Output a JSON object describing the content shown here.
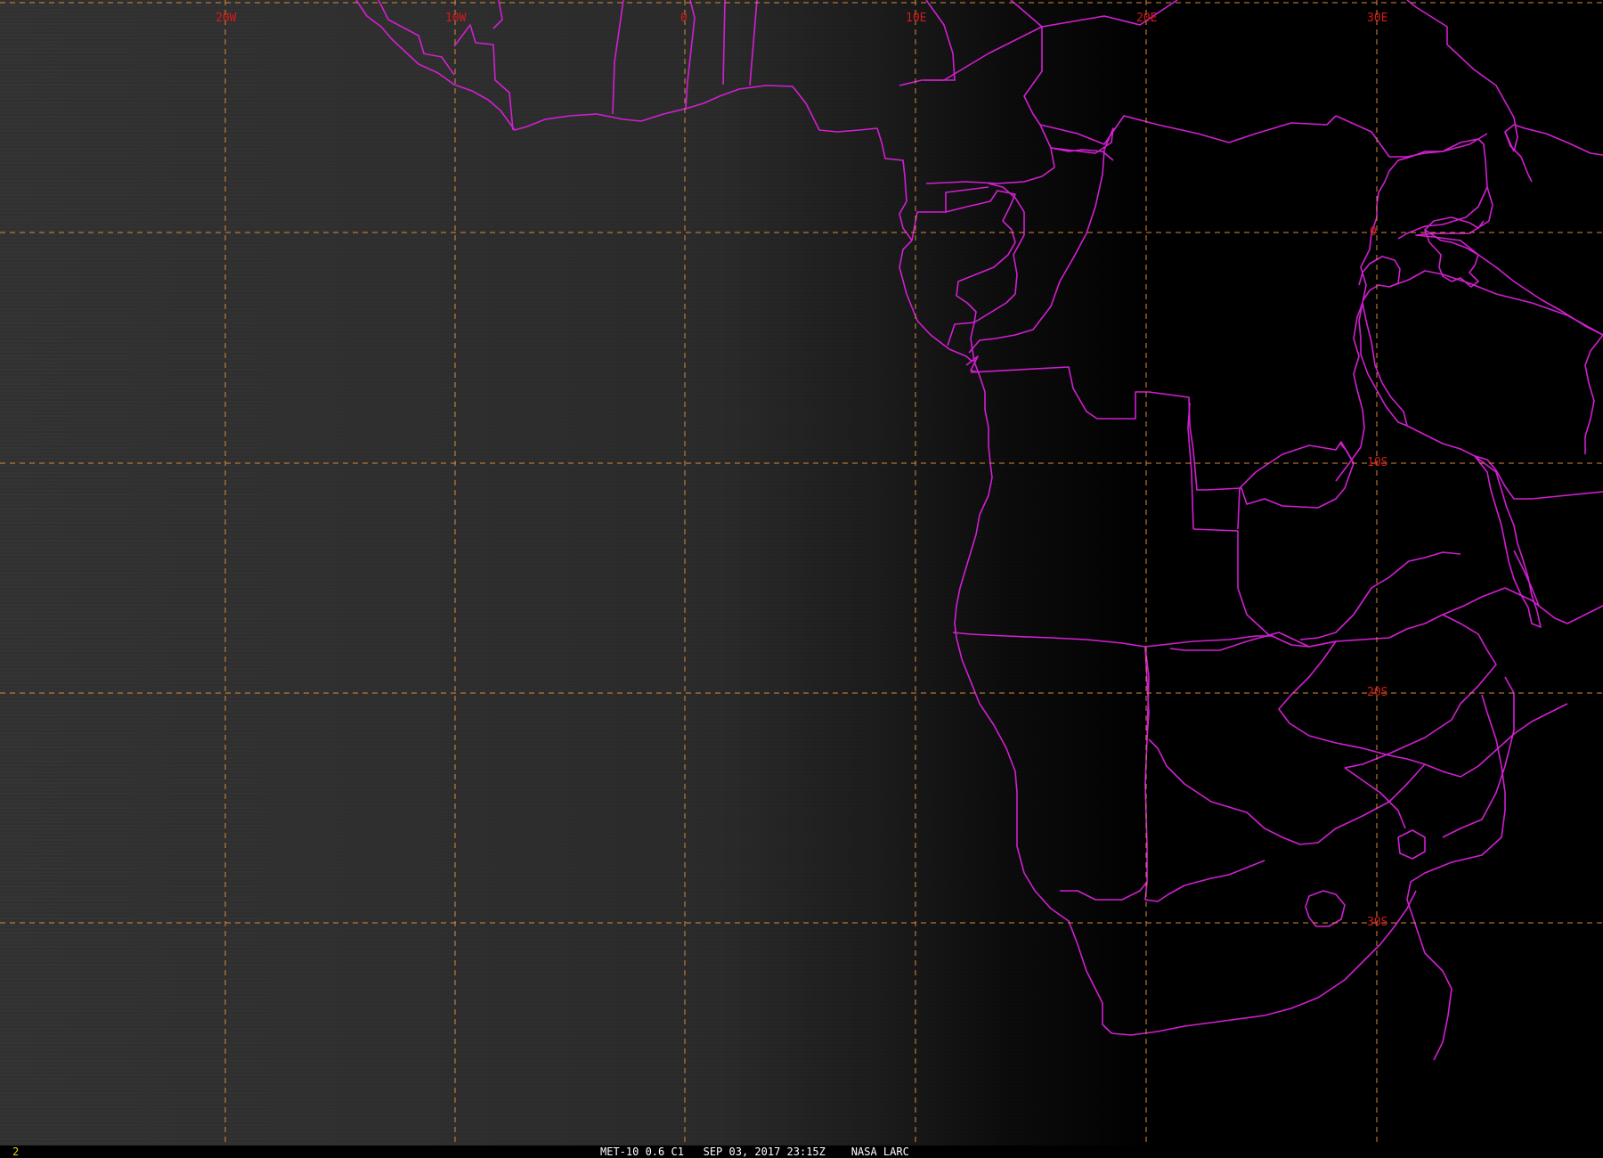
{
  "image": {
    "status_bar": {
      "frame_number": "2",
      "satellite_product": "MET-10 0.6 C1",
      "date_time": "SEP 03, 2017 23:15Z",
      "source": "NASA LARC"
    },
    "grid_labels": {
      "longitude": [
        "20W",
        "10W",
        "0",
        "10E",
        "20E",
        "30E"
      ],
      "latitude": [
        "0",
        "10S",
        "20S",
        "30S"
      ]
    },
    "colors": {
      "grid": "#d98a3a",
      "grid_label": "#d61a1a",
      "boundaries": "#d21fd2",
      "frame_number": "#e6d21e"
    }
  }
}
